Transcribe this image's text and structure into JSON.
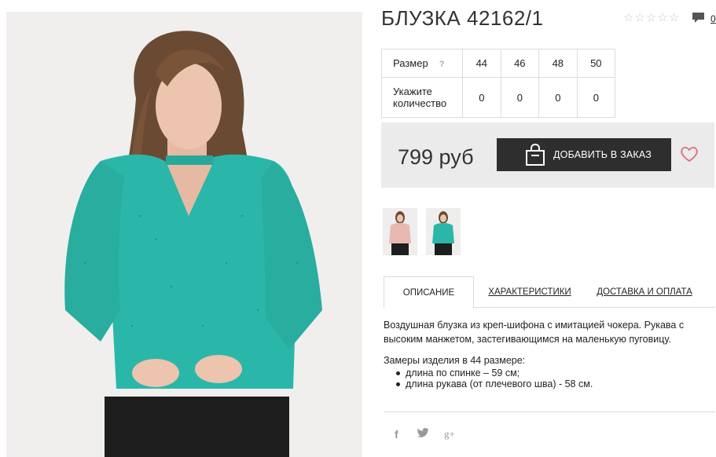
{
  "product": {
    "title": "БЛУЗКА 42162/1",
    "rating_stars": 5,
    "rating_value": 0,
    "comment_count": "0"
  },
  "sizes": {
    "size_label": "Размер",
    "help": "?",
    "quantity_label": "Укажите количество",
    "columns": [
      "44",
      "46",
      "48",
      "50"
    ],
    "quantities": [
      "0",
      "0",
      "0",
      "0"
    ]
  },
  "purchase": {
    "price": "799 руб",
    "add_label": "ДОБАВИТЬ В ЗАКАЗ"
  },
  "tabs": [
    {
      "label": "ОПИСАНИЕ"
    },
    {
      "label": "ХАРАКТЕРИСТИКИ"
    },
    {
      "label": "ДОСТАВКА И ОПЛАТА"
    }
  ],
  "description": {
    "text": "Воздушная блузка из креп-шифона с имитацией чокера. Рукава с высоким манжетом, застегивающимся на маленькую пуговицу.",
    "measurements_title": "Замеры изделия в 44 размере:",
    "measurements": [
      "длина по спинке – 59 см;",
      "длина рукава (от плечевого шва) - 58 см."
    ]
  },
  "social": {
    "facebook": "f",
    "twitter": "🐦",
    "google": "g+"
  },
  "colors": {
    "accent_dark": "#2e2e2e",
    "blouse": "#2ab7a9",
    "heart": "#e0707b"
  },
  "icons": [
    "star-icon",
    "comment-icon",
    "bag-icon",
    "heart-icon",
    "facebook-icon",
    "twitter-icon",
    "google-plus-icon"
  ]
}
